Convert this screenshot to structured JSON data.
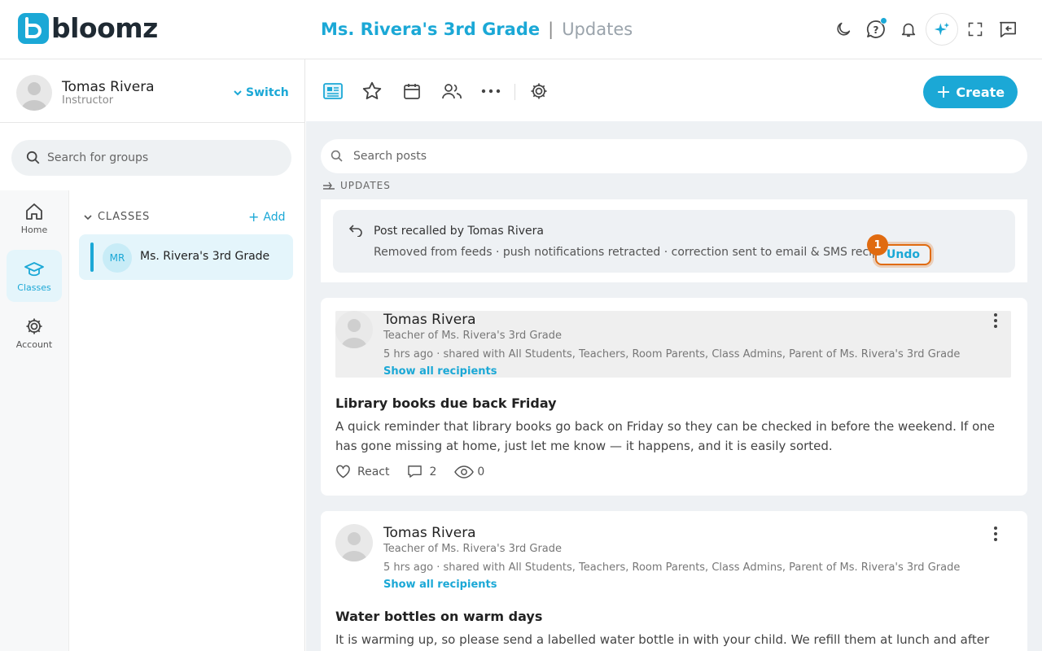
{
  "app": {
    "logo_letter": "b",
    "logo_text": "bloomz",
    "brand_color": "#1ba8d6",
    "accent_orange": "#e06b10"
  },
  "header": {
    "group_title": "Ms. Rivera's 3rd Grade",
    "separator": "|",
    "section_title": "Updates",
    "icons": [
      "moon-icon",
      "help-bubble-icon",
      "bell-icon",
      "sparkle-icon",
      "fullscreen-icon",
      "panel-collapse-icon"
    ]
  },
  "profile": {
    "name": "Tomas Rivera",
    "role": "Instructor",
    "switch_label": "Switch"
  },
  "sidebar": {
    "search_placeholder": "Search for groups",
    "nav": [
      {
        "label": "Home",
        "icon": "home-icon"
      },
      {
        "label": "Classes",
        "icon": "graduation-cap-icon",
        "active": true
      },
      {
        "label": "Account",
        "icon": "gear-icon"
      }
    ],
    "classes_heading": "CLASSES",
    "add_label": "Add",
    "class_items": [
      {
        "initials": "MR",
        "name": "Ms. Rivera's 3rd Grade"
      }
    ]
  },
  "toolbar": {
    "create_label": "Create",
    "tools": [
      "posts-icon",
      "star-icon",
      "calendar-icon",
      "people-icon",
      "more-icon",
      "settings-icon"
    ]
  },
  "feed": {
    "search_placeholder": "Search posts",
    "section_label": "UPDATES",
    "recall_notice": {
      "title": "Post recalled by Tomas Rivera",
      "description": "Removed from feeds · push notifications retracted · correction sent to email & SMS recipients",
      "undo_label": "Undo",
      "marker": "1"
    },
    "posts": [
      {
        "author": "Tomas Rivera",
        "role": "Teacher of Ms. Rivera's 3rd Grade",
        "meta": "5 hrs ago · shared with All Students, Teachers, Room Parents, Class Admins, Parent of Ms. Rivera's 3rd Grade",
        "recipients_link": "Show all recipients",
        "title": "Library books due back Friday",
        "body": "A quick reminder that library books go back on Friday so they can be checked in before the weekend. If one has gone missing at home, just let me know — it happens, and it is easily sorted.",
        "react_label": "React",
        "comments": "2",
        "views": "0"
      },
      {
        "author": "Tomas Rivera",
        "role": "Teacher of Ms. Rivera's 3rd Grade",
        "meta": "5 hrs ago · shared with All Students, Teachers, Room Parents, Class Admins, Parent of Ms. Rivera's 3rd Grade",
        "recipients_link": "Show all recipients",
        "title": "Water bottles on warm days",
        "body": "It is warming up, so please send a labelled water bottle in with your child. We refill them at lunch and after"
      }
    ]
  }
}
